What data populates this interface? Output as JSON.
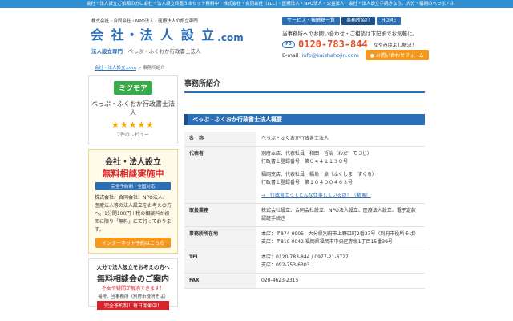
{
  "topbar": {
    "text": "会社・法人設立ご依頼の方に会社・法人設立印鑑３本セット無料中！株式会社・合同会社（LLC）・医療法人・NPO法人・公益法人　会社・法人設立手続きなら、大分・福岡のべっぷ・ふ"
  },
  "logo": {
    "sub": "株式会社・合同会社・NPO法人・医療法人の設立専門",
    "main": "会 社・法 人 設 立",
    "dotcom": ".com",
    "tag_prefix": "法人設立専門",
    "tag": "べっぷ・ふくおか行政書士法人"
  },
  "nav": [
    {
      "label": "サービス・報酬額一覧"
    },
    {
      "label": "事務所紹介"
    },
    {
      "label": "HOME"
    }
  ],
  "contact": {
    "line": "当事務所へのお問い合わせ・ご相談は下記までお気軽に。",
    "freedial_badge": "FD",
    "phone": "0120-783-844",
    "phone_note": "なやみはよし解決！",
    "email_label": "E-mail",
    "email": "info@kaishahojin.com",
    "inquiry_button": "お問い合わせフォーム"
  },
  "breadcrumb": {
    "home": "会社・法人設立.com",
    "sep": ">",
    "current": "事務所紹介"
  },
  "sidebar": {
    "review": {
      "brand": "ミツモア",
      "name": "べっぷ・ふくおか行政書士法人",
      "stars": "★★★★★",
      "count": "7件のレビュー"
    },
    "consult": {
      "title1": "会社・法人設立",
      "title2_red": "無料",
      "title2_rest": "相談実施中",
      "bar": "完全予約制・全国対応",
      "text": "株式会社、合同会社、NPO法人、医療法人等の法人設立をお考えの方へ。1分間100円＋税の相談料が初回に限り「無料」にて行っております。",
      "button": "インターネット予約はこちら"
    },
    "guide": {
      "g1": "大分で法人設立をお考えの方へ",
      "g2": "無料相談会のご案内",
      "g3": "不安や疑問が解消できます！",
      "g4": "場所：当事務所（別府市役所そば）",
      "g5": "完全予約制！毎日開催中！"
    }
  },
  "main": {
    "page_title": "事務所紹介",
    "section_title": "べっぷ・ふくおか行政書士法人概要",
    "rows": [
      {
        "label": "名　称",
        "lines": [
          "べっぷ・ふくおか行政書士法人"
        ]
      },
      {
        "label": "代表者",
        "lines": [
          "別府本店：代表社員　和田　哲治（わだ　てつじ）",
          "行政書士登録番号　第０４４１１３０号",
          "",
          "福岡支店：代表社員　福島　卓（ふくしま　すぐる）",
          "行政書士登録番号　第１０４００４６３号"
        ],
        "link": "→　行政書士ってどんな仕事しているの？（動画）"
      },
      {
        "label": "取扱業務",
        "lines": [
          "株式会社設立、合同会社設立、NPO法人設立、医療法人設立、電子定款認証手続き"
        ]
      },
      {
        "label": "事務所所在地",
        "lines": [
          "本店：〒874-0905　大分県別府市上野口町2番37号（別府市役所そば）",
          "支店：〒810-0042 福岡県福岡市中央区赤坂1丁目15番39号"
        ]
      },
      {
        "label": "TEL",
        "lines": [
          "本店：0120-783-844 / 0977-21-6727",
          "支店：092-753-6303"
        ]
      },
      {
        "label": "FAX",
        "lines": [
          "020-4623-2315"
        ]
      }
    ]
  }
}
